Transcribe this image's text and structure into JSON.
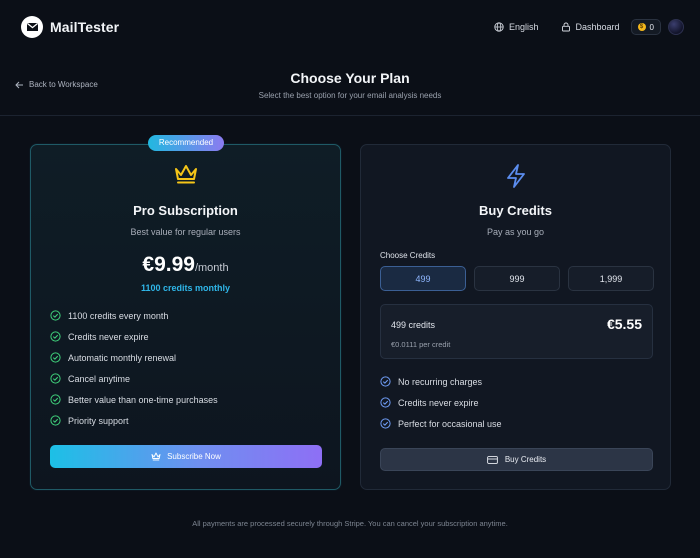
{
  "app": {
    "name": "MailTester"
  },
  "nav": {
    "language": "English",
    "dashboard": "Dashboard",
    "credit_count": "0"
  },
  "header": {
    "back_label": "Back to Workspace",
    "title": "Choose Your Plan",
    "subtitle": "Select the best option for your email analysis needs"
  },
  "pro": {
    "badge": "Recommended",
    "title": "Pro Subscription",
    "subtitle": "Best value for regular users",
    "price": "€9.99",
    "period": "/month",
    "credits_note": "1100 credits monthly",
    "features": [
      "1100 credits every month",
      "Credits never expire",
      "Automatic monthly renewal",
      "Cancel anytime",
      "Better value than one-time purchases",
      "Priority support"
    ],
    "button_label": "Subscribe Now"
  },
  "credits": {
    "title": "Buy Credits",
    "subtitle": "Pay as you go",
    "choose_label": "Choose Credits",
    "options": [
      "499",
      "999",
      "1,999"
    ],
    "selected_option": "499",
    "summary": {
      "credits": "499 credits",
      "price": "€5.55",
      "per_credit": "€0.0111 per credit"
    },
    "features": [
      "No recurring charges",
      "Credits never expire",
      "Perfect for occasional use"
    ],
    "button_label": "Buy Credits"
  },
  "footer": {
    "note": "All payments are processed securely through Stripe. You can cancel your subscription anytime."
  },
  "colors": {
    "accent_cyan": "#1cc0e6",
    "accent_purple": "#8e6ff5",
    "crown": "#f5c518",
    "bolt": "#5b8def",
    "check_pro": "#3fcf7a",
    "check_credits": "#6f9cf5"
  }
}
